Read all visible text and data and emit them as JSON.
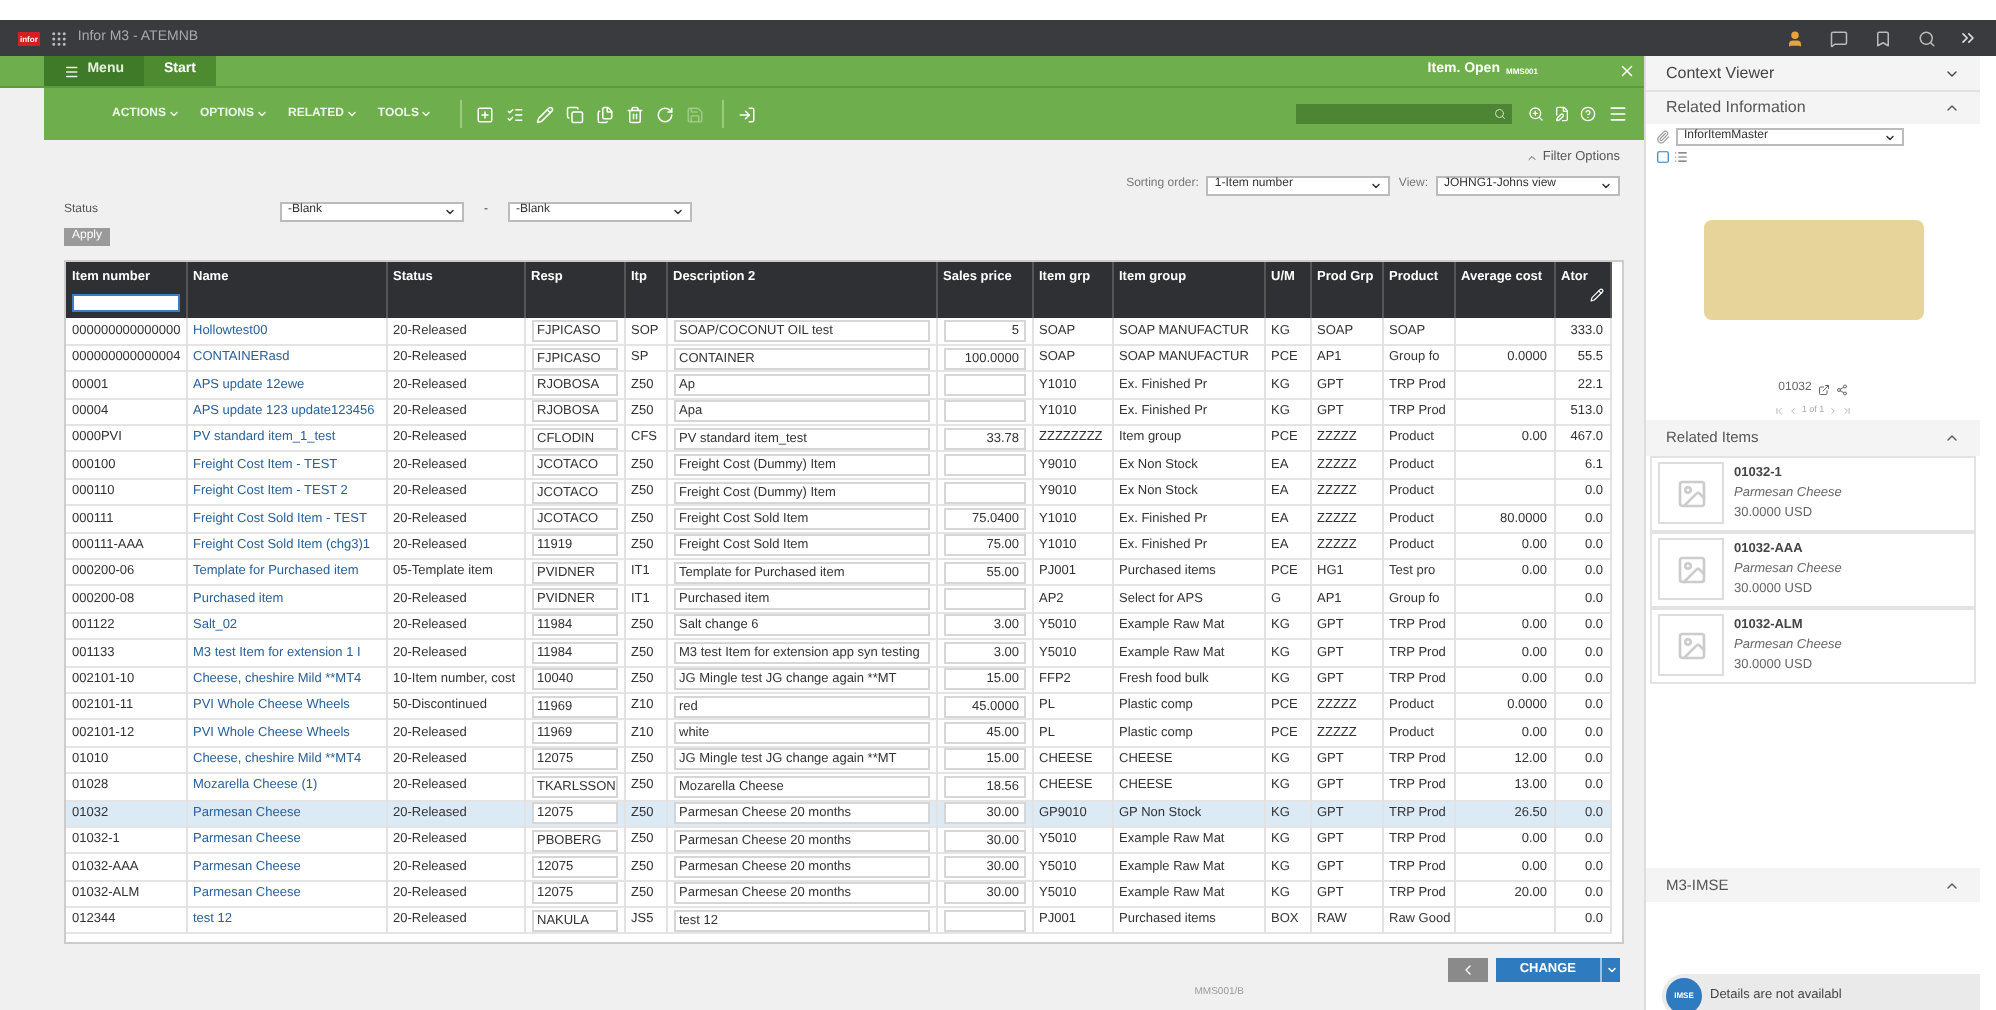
{
  "topbar": {
    "logo": "infor",
    "title": "Infor M3 - ATEMNB"
  },
  "tabs": [
    {
      "label": "Menu",
      "kind": "menu",
      "selected": false
    },
    {
      "label": "Start",
      "kind": "tab",
      "selected": true
    }
  ],
  "window": {
    "title": "Item. Open",
    "program": "MMS001"
  },
  "toolbar": {
    "menus": [
      "ACTIONS",
      "OPTIONS",
      "RELATED",
      "TOOLS"
    ]
  },
  "filter": {
    "toggle": "Filter Options",
    "sort_label": "Sorting order:",
    "sort_value": "1-Item number",
    "view_label": "View:",
    "view_value": "JOHNG1-Johns view",
    "status_label": "Status",
    "status_from": "-Blank",
    "dash": "-",
    "status_to": "-Blank",
    "apply": "Apply"
  },
  "table": {
    "columns": [
      {
        "label": "Item number",
        "kind": "text",
        "filter": true
      },
      {
        "label": "Name",
        "kind": "link",
        "filter": false
      },
      {
        "label": "Status",
        "kind": "text",
        "filter": false
      },
      {
        "label": "Resp",
        "kind": "input",
        "filter": false
      },
      {
        "label": "Itp",
        "kind": "text",
        "filter": false
      },
      {
        "label": "Description 2",
        "kind": "input",
        "filter": false
      },
      {
        "label": "Sales price",
        "kind": "input-num",
        "filter": false
      },
      {
        "label": "Item grp",
        "kind": "text",
        "filter": false
      },
      {
        "label": "Item group",
        "kind": "text",
        "filter": false
      },
      {
        "label": "U/M",
        "kind": "text",
        "filter": false
      },
      {
        "label": "Prod Grp",
        "kind": "text",
        "filter": false
      },
      {
        "label": "Product",
        "kind": "text",
        "filter": false
      },
      {
        "label": "Average cost",
        "kind": "num",
        "filter": false
      },
      {
        "label": "Ator",
        "kind": "num",
        "filter": false
      }
    ],
    "rows": [
      {
        "selected": false,
        "cells": [
          "000000000000000",
          "Hollowtest00",
          "20-Released",
          "FJPICASO",
          "SOP",
          "SOAP/COCONUT OIL test",
          "5",
          "SOAP",
          "SOAP MANUFACTUR",
          "KG",
          "SOAP",
          "SOAP",
          "",
          "333.0"
        ]
      },
      {
        "selected": false,
        "cells": [
          "000000000000004",
          "CONTAINERasd",
          "20-Released",
          "FJPICASO",
          "SP",
          "CONTAINER",
          "100.0000",
          "SOAP",
          "SOAP MANUFACTUR",
          "PCE",
          "AP1",
          "Group fo",
          "0.0000",
          "55.5"
        ]
      },
      {
        "selected": false,
        "cells": [
          "00001",
          "APS update 12ewe",
          "20-Released",
          "RJOBOSA",
          "Z50",
          "Ap",
          "",
          "Y1010",
          "Ex. Finished Pr",
          "KG",
          "GPT",
          "TRP Prod",
          "",
          "22.1"
        ]
      },
      {
        "selected": false,
        "cells": [
          "00004",
          "APS update 123 update123456",
          "20-Released",
          "RJOBOSA",
          "Z50",
          "Apa",
          "",
          "Y1010",
          "Ex. Finished Pr",
          "KG",
          "GPT",
          "TRP Prod",
          "",
          "513.0"
        ]
      },
      {
        "selected": false,
        "cells": [
          "0000PVI",
          "PV standard item_1_test",
          "20-Released",
          "CFLODIN",
          "CFS",
          "PV standard item_test",
          "33.78",
          "ZZZZZZZZ",
          "Item group",
          "PCE",
          "ZZZZZ",
          "Product",
          "0.00",
          "467.0"
        ]
      },
      {
        "selected": false,
        "cells": [
          "000100",
          "Freight Cost Item - TEST",
          "20-Released",
          "JCOTACO",
          "Z50",
          "Freight Cost (Dummy) Item",
          "",
          "Y9010",
          "Ex Non Stock",
          "EA",
          "ZZZZZ",
          "Product",
          "",
          "6.1"
        ]
      },
      {
        "selected": false,
        "cells": [
          "000110",
          "Freight Cost Item - TEST 2",
          "20-Released",
          "JCOTACO",
          "Z50",
          "Freight Cost (Dummy) Item",
          "",
          "Y9010",
          "Ex Non Stock",
          "EA",
          "ZZZZZ",
          "Product",
          "",
          "0.0"
        ]
      },
      {
        "selected": false,
        "cells": [
          "000111",
          "Freight Cost Sold Item - TEST",
          "20-Released",
          "JCOTACO",
          "Z50",
          "Freight Cost Sold Item",
          "75.0400",
          "Y1010",
          "Ex. Finished Pr",
          "EA",
          "ZZZZZ",
          "Product",
          "80.0000",
          "0.0"
        ]
      },
      {
        "selected": false,
        "cells": [
          "000111-AAA",
          "Freight Cost Sold Item (chg3)1",
          "20-Released",
          "11919",
          "Z50",
          "Freight Cost Sold Item",
          "75.00",
          "Y1010",
          "Ex. Finished Pr",
          "EA",
          "ZZZZZ",
          "Product",
          "0.00",
          "0.0"
        ]
      },
      {
        "selected": false,
        "cells": [
          "000200-06",
          "Template for Purchased item",
          "05-Template item",
          "PVIDNER",
          "IT1",
          "Template for Purchased item",
          "55.00",
          "PJ001",
          "Purchased items",
          "PCE",
          "HG1",
          "Test pro",
          "0.00",
          "0.0"
        ]
      },
      {
        "selected": false,
        "cells": [
          "000200-08",
          "Purchased item",
          "20-Released",
          "PVIDNER",
          "IT1",
          "Purchased item",
          "",
          "AP2",
          "Select for APS",
          "G",
          "AP1",
          "Group fo",
          "",
          "0.0"
        ]
      },
      {
        "selected": false,
        "cells": [
          "001122",
          "Salt_02",
          "20-Released",
          "11984",
          "Z50",
          "Salt change 6",
          "3.00",
          "Y5010",
          "Example Raw Mat",
          "KG",
          "GPT",
          "TRP Prod",
          "0.00",
          "0.0"
        ]
      },
      {
        "selected": false,
        "cells": [
          "001133",
          "M3 test Item for extension 1 I",
          "20-Released",
          "11984",
          "Z50",
          "M3 test Item for extension app syn testing",
          "3.00",
          "Y5010",
          "Example Raw Mat",
          "KG",
          "GPT",
          "TRP Prod",
          "0.00",
          "0.0"
        ]
      },
      {
        "selected": false,
        "cells": [
          "002101-10",
          "Cheese, cheshire Mild **MT4",
          "10-Item number, cost",
          "10040",
          "Z50",
          "JG Mingle test JG change again **MT",
          "15.00",
          "FFP2",
          "Fresh food bulk",
          "KG",
          "GPT",
          "TRP Prod",
          "0.00",
          "0.0"
        ]
      },
      {
        "selected": false,
        "cells": [
          "002101-11",
          "PVI Whole Cheese Wheels",
          "50-Discontinued",
          "11969",
          "Z10",
          "red",
          "45.0000",
          "PL",
          "Plastic comp",
          "PCE",
          "ZZZZZ",
          "Product",
          "0.0000",
          "0.0"
        ]
      },
      {
        "selected": false,
        "cells": [
          "002101-12",
          "PVI Whole Cheese Wheels",
          "20-Released",
          "11969",
          "Z10",
          "white",
          "45.00",
          "PL",
          "Plastic comp",
          "PCE",
          "ZZZZZ",
          "Product",
          "0.00",
          "0.0"
        ]
      },
      {
        "selected": false,
        "cells": [
          "01010",
          "Cheese, cheshire Mild **MT4",
          "20-Released",
          "12075",
          "Z50",
          "JG Mingle test JG change again **MT",
          "15.00",
          "CHEESE",
          "CHEESE",
          "KG",
          "GPT",
          "TRP Prod",
          "12.00",
          "0.0"
        ]
      },
      {
        "selected": false,
        "cells": [
          "01028",
          "Mozarella Cheese (1)",
          "20-Released",
          "TKARLSSON",
          "Z50",
          "Mozarella Cheese",
          "18.56",
          "CHEESE",
          "CHEESE",
          "KG",
          "GPT",
          "TRP Prod",
          "13.00",
          "0.0"
        ]
      },
      {
        "selected": true,
        "cells": [
          "01032",
          "Parmesan Cheese",
          "20-Released",
          "12075",
          "Z50",
          "Parmesan Cheese 20 months",
          "30.00",
          "GP9010",
          "GP Non Stock",
          "KG",
          "GPT",
          "TRP Prod",
          "26.50",
          "0.0"
        ]
      },
      {
        "selected": false,
        "cells": [
          "01032-1",
          "Parmesan Cheese",
          "20-Released",
          "PBOBERG",
          "Z50",
          "Parmesan Cheese 20 months",
          "30.00",
          "Y5010",
          "Example Raw Mat",
          "KG",
          "GPT",
          "TRP Prod",
          "0.00",
          "0.0"
        ]
      },
      {
        "selected": false,
        "cells": [
          "01032-AAA",
          "Parmesan Cheese",
          "20-Released",
          "12075",
          "Z50",
          "Parmesan Cheese 20 months",
          "30.00",
          "Y5010",
          "Example Raw Mat",
          "KG",
          "GPT",
          "TRP Prod",
          "0.00",
          "0.0"
        ]
      },
      {
        "selected": false,
        "cells": [
          "01032-ALM",
          "Parmesan Cheese",
          "20-Released",
          "12075",
          "Z50",
          "Parmesan Cheese 20 months",
          "30.00",
          "Y5010",
          "Example Raw Mat",
          "KG",
          "GPT",
          "TRP Prod",
          "20.00",
          "0.0"
        ]
      },
      {
        "selected": false,
        "cells": [
          "012344",
          "test 12",
          "20-Released",
          "NAKULA",
          "JS5",
          "test 12",
          "",
          "PJ001",
          "Purchased items",
          "BOX",
          "RAW",
          "Raw Good",
          "",
          "0.0"
        ]
      }
    ]
  },
  "actions": {
    "change": "CHANGE"
  },
  "status_bar": {
    "program": "MMS001/B"
  },
  "side": {
    "context_viewer": "Context Viewer",
    "related_information": "Related Information",
    "source": "InforItemMaster",
    "image_caption": "01032",
    "pager": "1 of 1",
    "related_items_title": "Related Items",
    "related_items": [
      {
        "id": "01032-1",
        "name": "Parmesan Cheese",
        "price": "30.0000 USD"
      },
      {
        "id": "01032-AAA",
        "name": "Parmesan Cheese",
        "price": "30.0000 USD"
      },
      {
        "id": "01032-ALM",
        "name": "Parmesan Cheese",
        "price": "30.0000 USD"
      }
    ],
    "imse_title": "M3-IMSE",
    "bubble_badge": "IMSE",
    "bubble_text": "Details are not availabl"
  }
}
